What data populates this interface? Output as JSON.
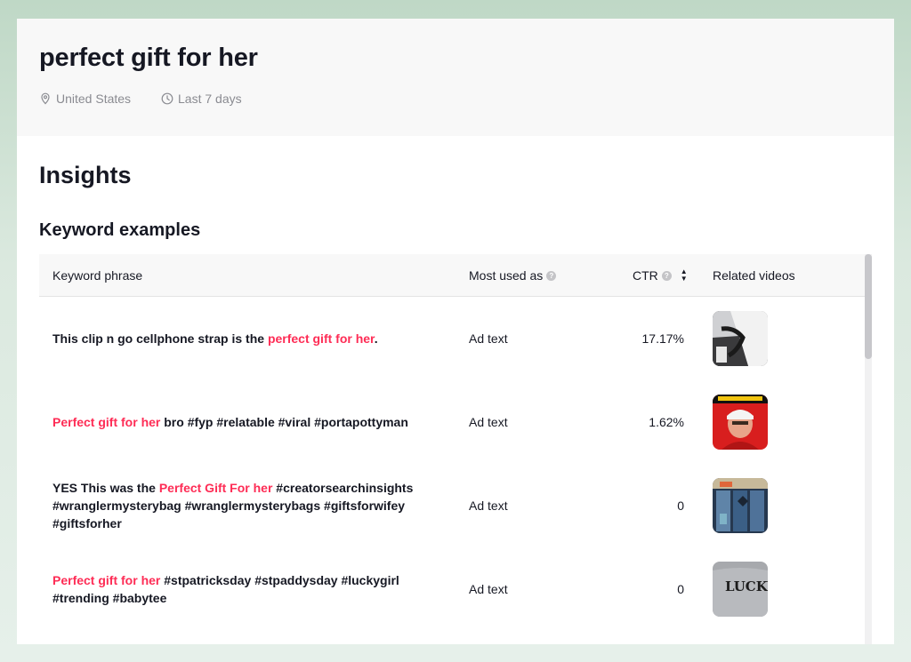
{
  "header": {
    "title": "perfect gift for her",
    "location": "United States",
    "time_range": "Last 7 days"
  },
  "insights": {
    "title": "Insights",
    "section_title": "Keyword examples"
  },
  "table": {
    "columns": {
      "phrase": "Keyword phrase",
      "most_used": "Most used as",
      "ctr": "CTR",
      "videos": "Related videos"
    },
    "rows": [
      {
        "phrase": [
          {
            "text": "This clip n go cellphone strap is the ",
            "hl": false
          },
          {
            "text": "perfect gift for her",
            "hl": true
          },
          {
            "text": ".",
            "hl": false
          }
        ],
        "most_used": "Ad text",
        "ctr": "17.17%",
        "thumb": "strap-video-thumbnail"
      },
      {
        "phrase": [
          {
            "text": "Perfect gift for her",
            "hl": true
          },
          {
            "text": " bro #fyp #relatable #viral #portapottyman",
            "hl": false
          }
        ],
        "most_used": "Ad text",
        "ctr": "1.62%",
        "thumb": "man-red-hat-video-thumbnail"
      },
      {
        "phrase": [
          {
            "text": "YES This was the ",
            "hl": false
          },
          {
            "text": "Perfect Gift For her",
            "hl": true
          },
          {
            "text": " #creatorsearchinsights #wranglermysterybag #wranglermysterybags #giftsforwifey #giftsforher",
            "hl": false
          }
        ],
        "most_used": "Ad text",
        "ctr": "0",
        "thumb": "jeans-video-thumbnail"
      },
      {
        "phrase": [
          {
            "text": "Perfect gift for her",
            "hl": true
          },
          {
            "text": " #stpatricksday #stpaddysday #luckygirl #trending #babytee",
            "hl": false
          }
        ],
        "most_used": "Ad text",
        "ctr": "0",
        "thumb": "lucky-tee-video-thumbnail",
        "thumb_text": "LUCKY"
      }
    ]
  },
  "colors": {
    "highlight": "#fe2c55",
    "text": "#161823",
    "muted": "#8a8b91"
  }
}
